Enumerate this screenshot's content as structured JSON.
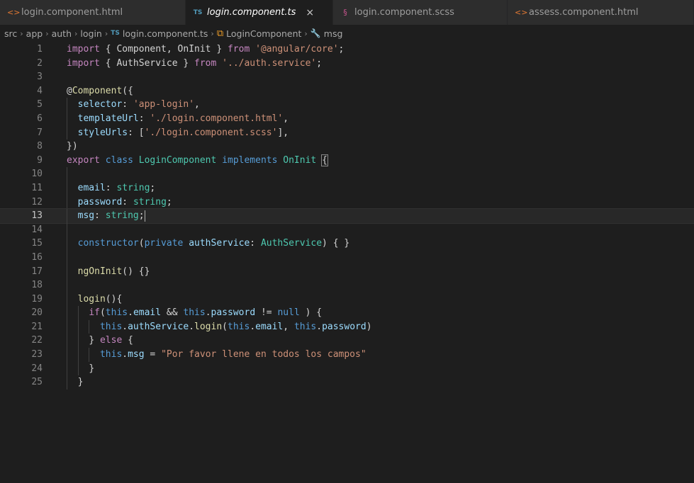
{
  "tabs": [
    {
      "icon": "<>",
      "label": "login.component.html",
      "active": false
    },
    {
      "icon": "TS",
      "label": "login.component.ts",
      "active": true,
      "close": "×"
    },
    {
      "icon": "§",
      "label": "login.component.scss",
      "active": false
    },
    {
      "icon": "<>",
      "label": "assess.component.html",
      "active": false
    }
  ],
  "breadcrumb": {
    "parts": [
      "src",
      "app",
      "auth",
      "login"
    ],
    "file": "login.component.ts",
    "class_name": "LoginComponent",
    "member": "msg"
  },
  "editor": {
    "current_line": 13,
    "lines": [
      {
        "n": "1",
        "indent": 0,
        "tokens": [
          [
            "kw2",
            "import"
          ],
          [
            "plain",
            " { Component, OnInit } "
          ],
          [
            "kw2",
            "from"
          ],
          [
            "plain",
            " "
          ],
          [
            "str",
            "'@angular/core'"
          ],
          [
            "plain",
            ";"
          ]
        ]
      },
      {
        "n": "2",
        "indent": 0,
        "tokens": [
          [
            "kw2",
            "import"
          ],
          [
            "plain",
            " { AuthService } "
          ],
          [
            "kw2",
            "from"
          ],
          [
            "plain",
            " "
          ],
          [
            "str",
            "'../auth.service'"
          ],
          [
            "plain",
            ";"
          ]
        ]
      },
      {
        "n": "3",
        "indent": 0,
        "tokens": []
      },
      {
        "n": "4",
        "indent": 0,
        "tokens": [
          [
            "plain",
            "@"
          ],
          [
            "fn",
            "Component"
          ],
          [
            "plain",
            "({"
          ]
        ]
      },
      {
        "n": "5",
        "indent": 1,
        "tokens": [
          [
            "prop",
            "selector"
          ],
          [
            "plain",
            ": "
          ],
          [
            "str",
            "'app-login'"
          ],
          [
            "plain",
            ","
          ]
        ]
      },
      {
        "n": "6",
        "indent": 1,
        "tokens": [
          [
            "prop",
            "templateUrl"
          ],
          [
            "plain",
            ": "
          ],
          [
            "str",
            "'./login.component.html'"
          ],
          [
            "plain",
            ","
          ]
        ]
      },
      {
        "n": "7",
        "indent": 1,
        "tokens": [
          [
            "prop",
            "styleUrls"
          ],
          [
            "plain",
            ": ["
          ],
          [
            "str",
            "'./login.component.scss'"
          ],
          [
            "plain",
            "],"
          ]
        ]
      },
      {
        "n": "8",
        "indent": 0,
        "tokens": [
          [
            "plain",
            "})"
          ]
        ]
      },
      {
        "n": "9",
        "indent": 0,
        "tokens": [
          [
            "kw2",
            "export"
          ],
          [
            "plain",
            " "
          ],
          [
            "kw",
            "class"
          ],
          [
            "plain",
            " "
          ],
          [
            "type",
            "LoginComponent"
          ],
          [
            "plain",
            " "
          ],
          [
            "kw",
            "implements"
          ],
          [
            "plain",
            " "
          ],
          [
            "type",
            "OnInit"
          ],
          [
            "plain",
            " "
          ],
          [
            "box",
            "{"
          ]
        ]
      },
      {
        "n": "10",
        "indent": 1,
        "tokens": []
      },
      {
        "n": "11",
        "indent": 1,
        "tokens": [
          [
            "prop",
            "email"
          ],
          [
            "plain",
            ": "
          ],
          [
            "type",
            "string"
          ],
          [
            "plain",
            ";"
          ]
        ]
      },
      {
        "n": "12",
        "indent": 1,
        "tokens": [
          [
            "prop",
            "password"
          ],
          [
            "plain",
            ": "
          ],
          [
            "type",
            "string"
          ],
          [
            "plain",
            ";"
          ]
        ]
      },
      {
        "n": "13",
        "indent": 1,
        "tokens": [
          [
            "prop",
            "msg"
          ],
          [
            "plain",
            ": "
          ],
          [
            "type",
            "string"
          ],
          [
            "plain",
            ";"
          ],
          [
            "cursor",
            ""
          ]
        ]
      },
      {
        "n": "14",
        "indent": 1,
        "tokens": []
      },
      {
        "n": "15",
        "indent": 1,
        "tokens": [
          [
            "kw",
            "constructor"
          ],
          [
            "plain",
            "("
          ],
          [
            "kw",
            "private"
          ],
          [
            "plain",
            " "
          ],
          [
            "prop",
            "authService"
          ],
          [
            "plain",
            ": "
          ],
          [
            "type",
            "AuthService"
          ],
          [
            "plain",
            ") { }"
          ]
        ]
      },
      {
        "n": "16",
        "indent": 1,
        "tokens": []
      },
      {
        "n": "17",
        "indent": 1,
        "tokens": [
          [
            "fn",
            "ngOnInit"
          ],
          [
            "plain",
            "() {}"
          ]
        ]
      },
      {
        "n": "18",
        "indent": 1,
        "tokens": []
      },
      {
        "n": "19",
        "indent": 1,
        "tokens": [
          [
            "fn",
            "login"
          ],
          [
            "plain",
            "(){"
          ]
        ]
      },
      {
        "n": "20",
        "indent": 2,
        "tokens": [
          [
            "kw2",
            "if"
          ],
          [
            "plain",
            "("
          ],
          [
            "kw",
            "this"
          ],
          [
            "plain",
            "."
          ],
          [
            "prop",
            "email"
          ],
          [
            "plain",
            " && "
          ],
          [
            "kw",
            "this"
          ],
          [
            "plain",
            "."
          ],
          [
            "prop",
            "password"
          ],
          [
            "plain",
            " != "
          ],
          [
            "kw",
            "null"
          ],
          [
            "plain",
            " ) {"
          ]
        ]
      },
      {
        "n": "21",
        "indent": 3,
        "tokens": [
          [
            "kw",
            "this"
          ],
          [
            "plain",
            "."
          ],
          [
            "prop",
            "authService"
          ],
          [
            "plain",
            "."
          ],
          [
            "fn",
            "login"
          ],
          [
            "plain",
            "("
          ],
          [
            "kw",
            "this"
          ],
          [
            "plain",
            "."
          ],
          [
            "prop",
            "email"
          ],
          [
            "plain",
            ", "
          ],
          [
            "kw",
            "this"
          ],
          [
            "plain",
            "."
          ],
          [
            "prop",
            "password"
          ],
          [
            "plain",
            ")"
          ]
        ]
      },
      {
        "n": "22",
        "indent": 2,
        "tokens": [
          [
            "plain",
            "} "
          ],
          [
            "kw2",
            "else"
          ],
          [
            "plain",
            " {"
          ]
        ]
      },
      {
        "n": "23",
        "indent": 3,
        "tokens": [
          [
            "kw",
            "this"
          ],
          [
            "plain",
            "."
          ],
          [
            "prop",
            "msg"
          ],
          [
            "plain",
            " = "
          ],
          [
            "str",
            "\"Por favor llene en todos los campos\""
          ]
        ]
      },
      {
        "n": "24",
        "indent": 2,
        "tokens": [
          [
            "plain",
            "}"
          ]
        ]
      },
      {
        "n": "25",
        "indent": 1,
        "tokens": [
          [
            "plain",
            "}"
          ]
        ]
      }
    ]
  }
}
